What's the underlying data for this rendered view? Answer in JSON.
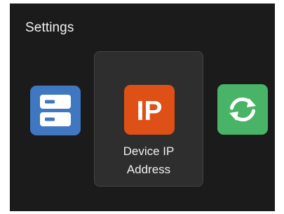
{
  "header": {
    "title": "Settings"
  },
  "apps": [
    {
      "id": "storage",
      "icon": "server-storage-icon",
      "color": "#3f77c1",
      "selected": false
    },
    {
      "id": "device-ip",
      "icon": "ip-icon",
      "icon_text": "IP",
      "label_line1": "Device IP",
      "label_line2": "Address",
      "color": "#de5016",
      "selected": true
    },
    {
      "id": "refresh",
      "icon": "refresh-sync-icon",
      "color": "#49b467",
      "selected": false
    }
  ],
  "colors": {
    "background": "#1b1b1b",
    "selected_card": "#2e2e2e",
    "text": "#f0f0f0"
  }
}
